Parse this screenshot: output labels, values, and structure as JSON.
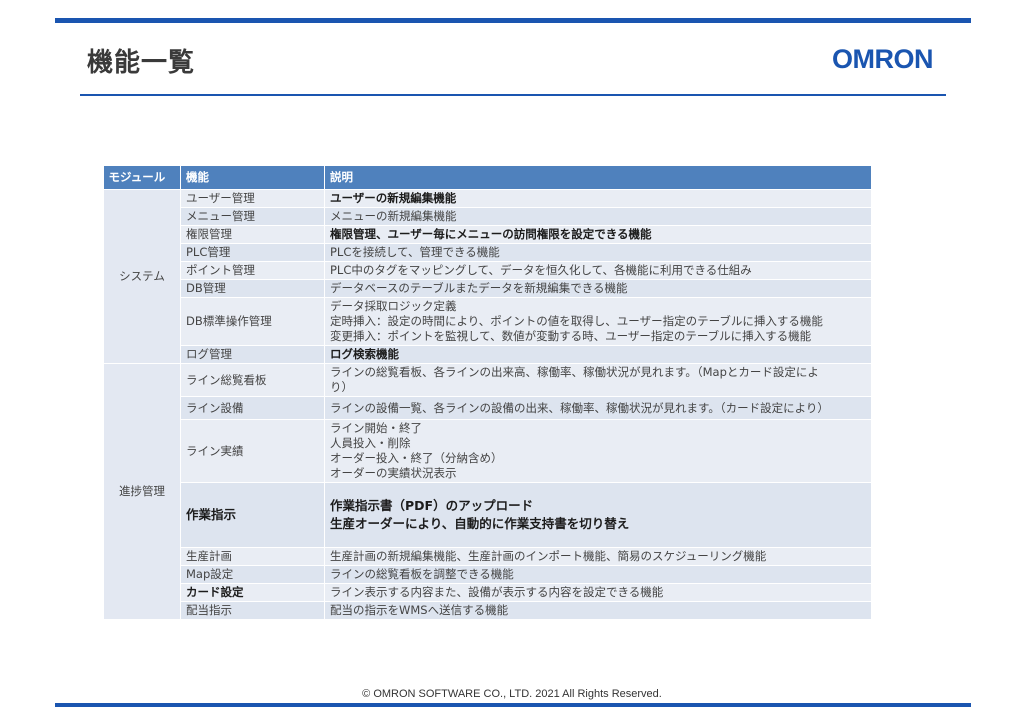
{
  "header": {
    "title": "機能一覧",
    "logo_text": "OMRON",
    "accent_color": "#1a55b0"
  },
  "table": {
    "header_color": "#4f81bd",
    "columns": [
      "モジュール",
      "機能",
      "説明"
    ],
    "modules": [
      "システム",
      "進捗管理"
    ],
    "rows": [
      {
        "func": "ユーザー管理",
        "desc": [
          "ユーザーの新規編集機能"
        ]
      },
      {
        "func": "メニュー管理",
        "desc": [
          "メニューの新規編集機能"
        ]
      },
      {
        "func": "権限管理",
        "desc": [
          "権限管理、ユーザー毎にメニューの訪問権限を設定できる機能"
        ]
      },
      {
        "func": "PLC管理",
        "desc": [
          "PLCを接続して、管理できる機能"
        ]
      },
      {
        "func": "ポイント管理",
        "desc": [
          "PLC中のタグをマッピングして、データを恒久化して、各機能に利用できる仕組み"
        ]
      },
      {
        "func": "DB管理",
        "desc": [
          "データベースのテーブルまたデータを新規編集できる機能"
        ]
      },
      {
        "func": "DB標準操作管理",
        "desc": [
          "データ採取ロジック定義",
          "定時挿入：設定の時間により、ポイントの値を取得し、ユーザー指定のテーブルに挿入する機能",
          "変更挿入：ポイントを監視して、数値が変動する時、ユーザー指定のテーブルに挿入する機能"
        ]
      },
      {
        "func": "ログ管理",
        "desc": [
          "ログ検索機能"
        ]
      },
      {
        "func": "ライン総覧看板",
        "desc": [
          "ラインの総覧看板、各ラインの出来高、稼働率、稼働状況が見れます。（Mapとカード設定によ",
          "り）"
        ]
      },
      {
        "func": "ライン設備",
        "desc": [
          "ラインの設備一覧、各ラインの設備の出来、稼働率、稼働状況が見れます。（カード設定により）"
        ]
      },
      {
        "func": "ライン実績",
        "desc": [
          "ライン開始・終了",
          "人員投入・削除",
          "オーダー投入・終了（分納含め）",
          "オーダーの実績状況表示"
        ]
      },
      {
        "func": "作業指示",
        "desc": [
          "作業指示書（PDF）のアップロード",
          "生産オーダーにより、自動的に作業支持書を切り替え"
        ]
      },
      {
        "func": "生産計画",
        "desc": [
          "生産計画の新規編集機能、生産計画のインポート機能、簡易のスケジューリング機能"
        ]
      },
      {
        "func": "Map設定",
        "desc": [
          "ラインの総覧看板を調整できる機能"
        ]
      },
      {
        "func": "カード設定",
        "desc": [
          "ライン表示する内容また、設備が表示する内容を設定できる機能"
        ]
      },
      {
        "func": "配当指示",
        "desc": [
          "配当の指示をWMSへ送信する機能"
        ]
      }
    ]
  },
  "footer": {
    "copyright": "©  OMRON SOFTWARE CO., LTD. 2021 All Rights Reserved."
  }
}
